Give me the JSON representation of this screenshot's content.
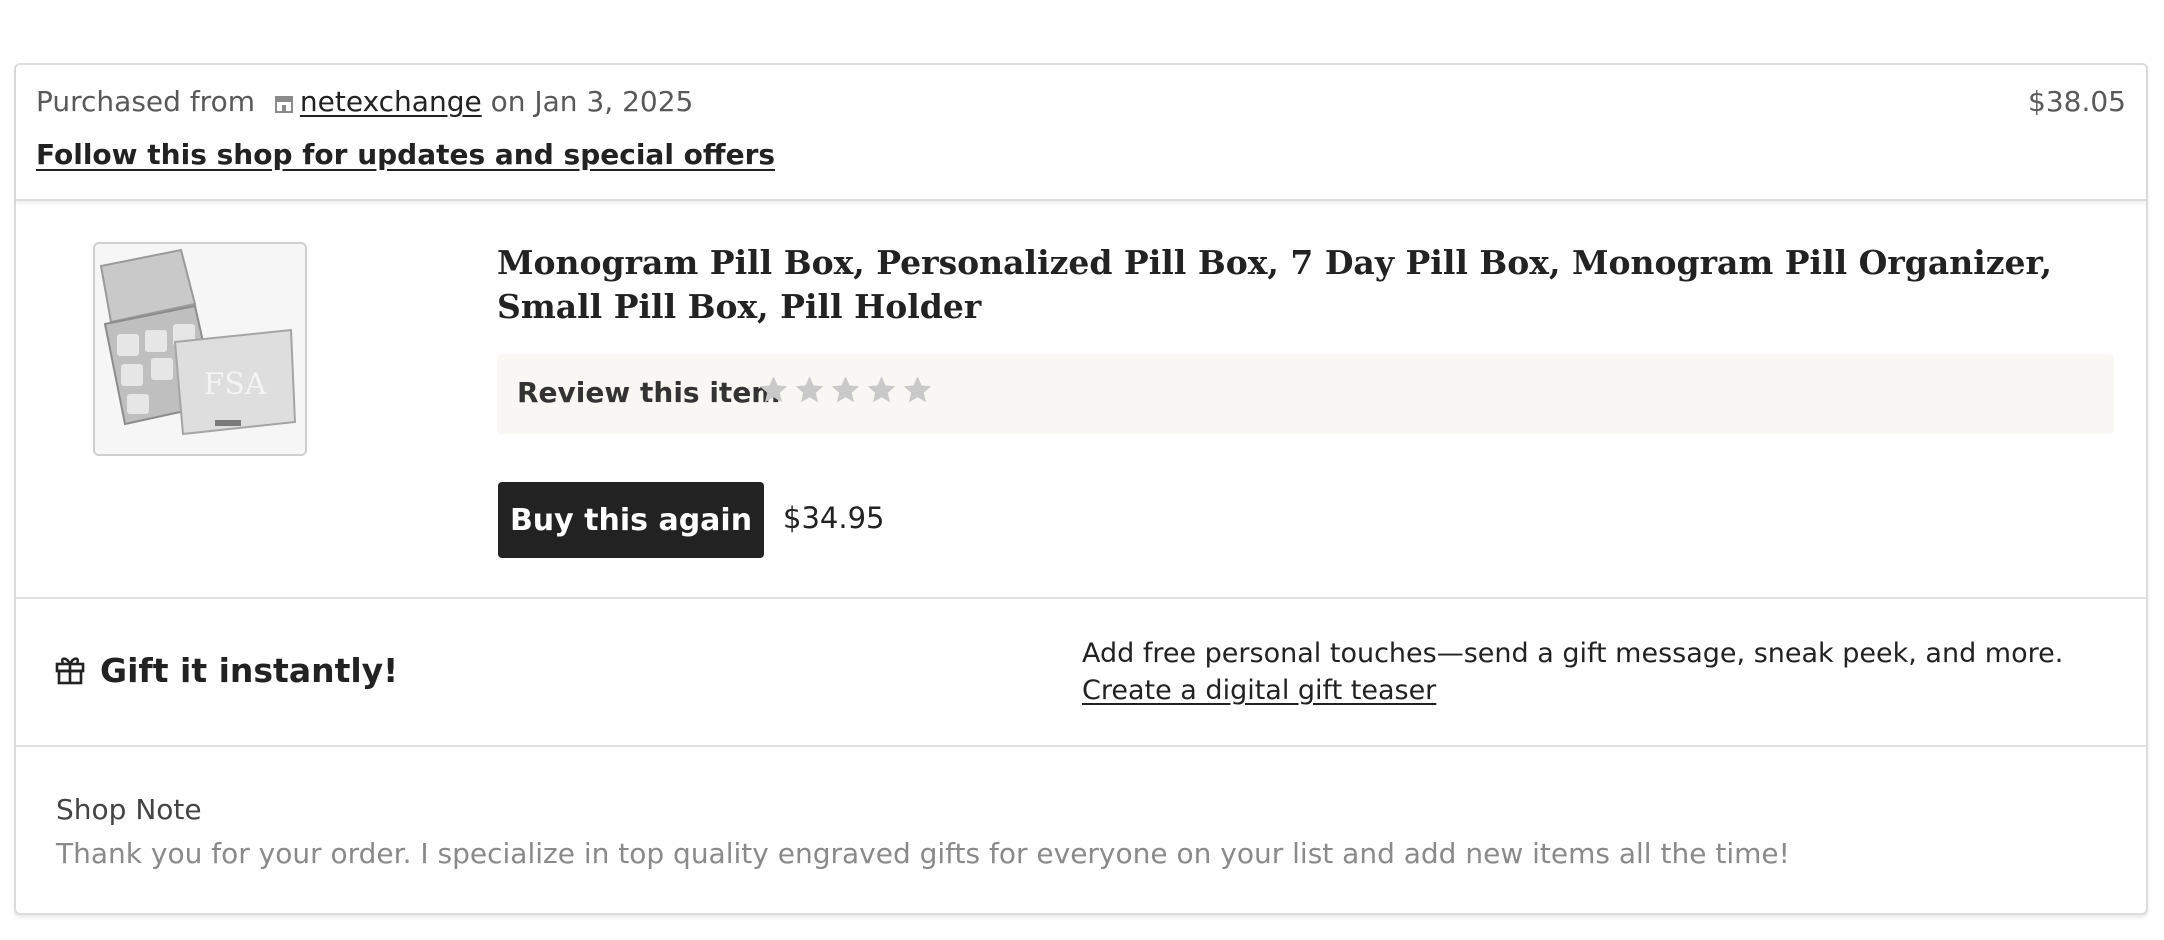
{
  "order": {
    "purchased_from_label": "Purchased from",
    "shop_name": "netexchange",
    "date_text": "on Jan 3, 2025",
    "total": "$38.05",
    "follow_link": "Follow this shop for updates and special offers"
  },
  "item": {
    "title": "Monogram Pill Box, Personalized Pill Box, 7 Day Pill Box, Monogram Pill Organizer, Small Pill Box, Pill Holder",
    "image_alt_icon": "pill-box-photo",
    "image_monogram": "FSA",
    "review_label": "Review this item",
    "star_count": 5,
    "rating": 0,
    "buy_again_label": "Buy this again",
    "price": "$34.95"
  },
  "gift": {
    "icon": "gift-icon",
    "title": "Gift it instantly!",
    "description": "Add free personal touches—send a gift message, sneak peek, and more.",
    "link": "Create a digital gift teaser"
  },
  "shop_note": {
    "label": "Shop Note",
    "text": "Thank you for your order. I specialize in top quality engraved gifts for everyone on your list and add new items all the time!"
  },
  "colors": {
    "button_bg": "#222222",
    "review_bg": "#f8f7f3",
    "star_empty": "#c9c9c9",
    "muted_text": "#8a8a8a"
  }
}
